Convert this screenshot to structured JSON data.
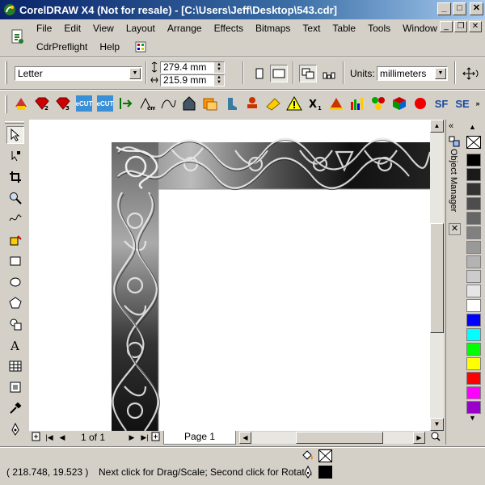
{
  "window": {
    "title": "CorelDRAW X4 (Not for resale) - [C:\\Users\\Jeff\\Desktop\\543.cdr]",
    "minimize": "_",
    "maximize": "□",
    "close": "✕"
  },
  "menu": {
    "items": [
      "File",
      "Edit",
      "View",
      "Layout",
      "Arrange",
      "Effects",
      "Bitmaps",
      "Text",
      "Table",
      "Tools",
      "Window"
    ],
    "items_row2": [
      "CdrPreflight",
      "Help"
    ]
  },
  "propbar": {
    "paper_size": "Letter",
    "width_value": "279.4 mm",
    "height_value": "215.9 mm",
    "units_label": "Units:",
    "units_value": "millimeters"
  },
  "navigation": {
    "page_count": "1 of 1",
    "page_tab": "Page 1"
  },
  "docker": {
    "title": "Object Manager"
  },
  "palette": {
    "colors": [
      "#ffffff",
      "#000000",
      "#1a1a1a",
      "#333333",
      "#4d4d4d",
      "#666666",
      "#808080",
      "#999999",
      "#b3b3b3",
      "#cccccc",
      "#e6e6e6",
      "#ffffff",
      "#0000ff",
      "#00ffff",
      "#00ff00",
      "#ffff00",
      "#ff0000",
      "#ff00ff",
      "#9900cc",
      "#ff00ff"
    ]
  },
  "status": {
    "coordinates": "( 218.748, 19.523 )",
    "hint": "Next click for Drag/Scale; Second click for Rotat..."
  }
}
